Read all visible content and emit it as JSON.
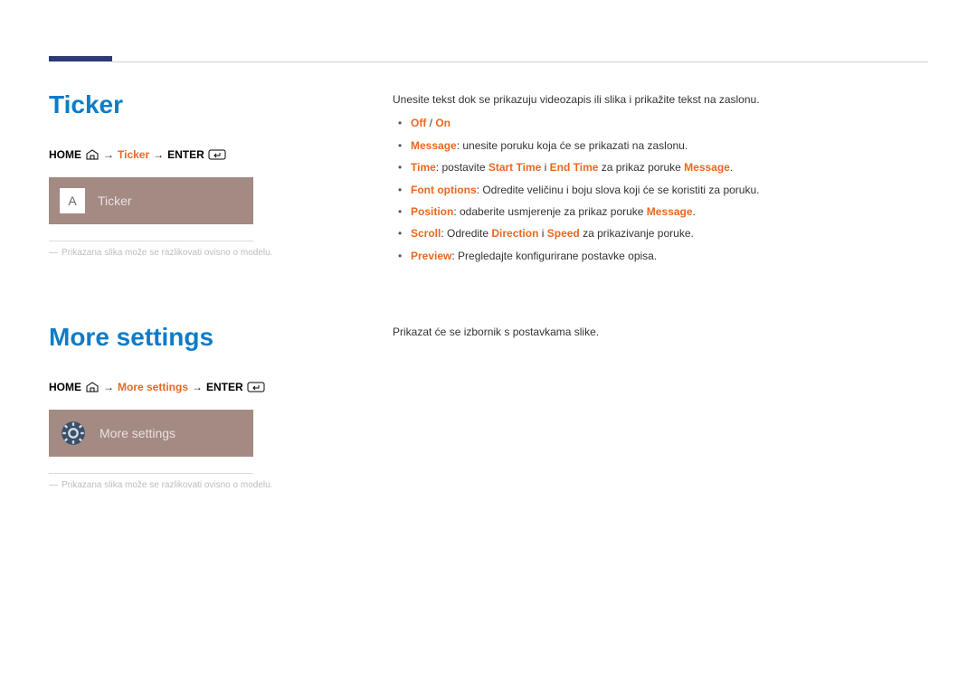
{
  "ticker": {
    "title": "Ticker",
    "breadcrumb": {
      "home": "HOME",
      "mid": "Ticker",
      "enter": "ENTER"
    },
    "thumb": {
      "icon_letter": "A",
      "label": "Ticker"
    },
    "note": "Prikazana slika može se razlikovati ovisno o modelu.",
    "intro": "Unesite tekst dok se prikazuju videozapis ili slika i prikažite tekst na zaslonu.",
    "bullets": {
      "off_on": {
        "off": "Off",
        "sep": " / ",
        "on": "On"
      },
      "message": {
        "key": "Message",
        "rest": ": unesite poruku koja će se prikazati na zaslonu."
      },
      "time": {
        "key": "Time",
        "pre": ": postavite ",
        "start": "Start Time",
        "i": " i ",
        "end": "End Time",
        "post": " za prikaz poruke ",
        "msg": "Message",
        "dot": "."
      },
      "font": {
        "key": "Font options",
        "rest": ": Odredite veličinu i boju slova koji će se koristiti za poruku."
      },
      "position": {
        "key": "Position",
        "pre": ": odaberite usmjerenje za prikaz poruke ",
        "msg": "Message",
        "dot": "."
      },
      "scroll": {
        "key": "Scroll",
        "pre": ": Odredite ",
        "dir": "Direction",
        "i": " i ",
        "spd": "Speed",
        "post": " za prikazivanje poruke."
      },
      "preview": {
        "key": "Preview",
        "rest": ": Pregledajte konfigurirane postavke opisa."
      }
    }
  },
  "more": {
    "title": "More settings",
    "breadcrumb": {
      "home": "HOME",
      "mid": "More settings",
      "enter": "ENTER"
    },
    "thumb": {
      "label": "More settings"
    },
    "note": "Prikazana slika može se razlikovati ovisno o modelu.",
    "intro": "Prikazat će se izbornik s postavkama slike."
  }
}
